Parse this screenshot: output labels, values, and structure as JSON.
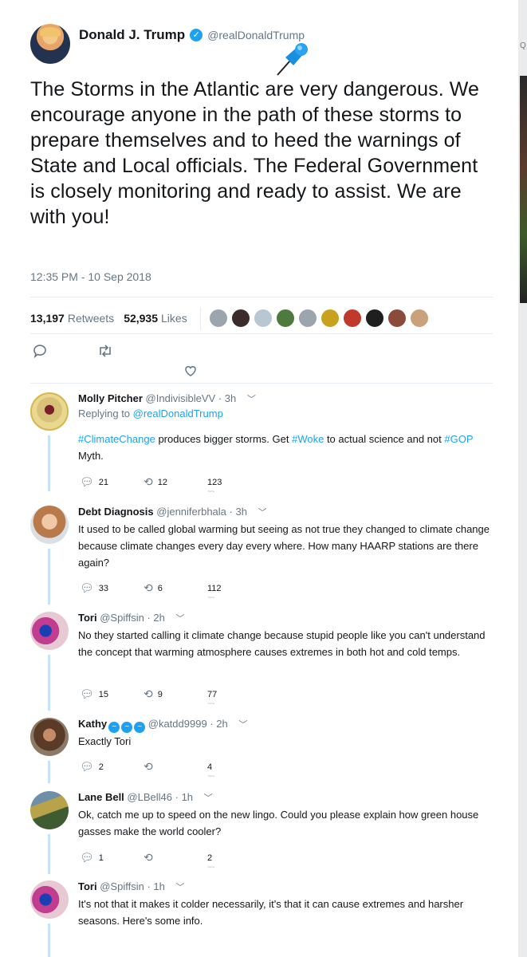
{
  "colors": {
    "accent": "#1da1f2",
    "muted": "#657786",
    "text": "#14171a",
    "thread": "#c5e3f6"
  },
  "main_tweet": {
    "display_name": "Donald J. Trump",
    "handle": "@realDonaldTrump",
    "text": "The Storms in the Atlantic are very dangerous. We encourage anyone in the path of these storms to prepare themselves and to heed the warnings of State and Local officials. The Federal Government is closely monitoring and ready to assist. We are with you!",
    "timestamp": "12:35 PM - 10 Sep 2018",
    "retweets_count": "13,197",
    "retweets_label": "Retweets",
    "likes_count": "52,935",
    "likes_label": "Likes",
    "icons": [
      "reply-icon",
      "retweet-icon",
      "like-icon",
      "pin-icon",
      "verified-badge-icon"
    ]
  },
  "gutter_mark": "Q",
  "replies": [
    {
      "name": "Molly Pitcher",
      "handle": "@IndivisibleVV",
      "time": "· 3h",
      "replying_prefix": "Replying to ",
      "replying_to": "@realDonaldTrump",
      "text_parts": [
        "#ClimateChange",
        " produces bigger storms. Get ",
        "#Woke",
        " to actual science and not ",
        "#GOP",
        " Myth."
      ],
      "reply_count": "21",
      "retweet_count": "12",
      "like_count": "123"
    },
    {
      "name": "Debt Diagnosis",
      "handle": "@jenniferbhala",
      "time": "· 3h",
      "text": "It used to be called global warming but seeing as not true they changed to climate change because climate changes every day every where. How many HAARP stations are there again?",
      "reply_count": "33",
      "retweet_count": "6",
      "like_count": "112"
    },
    {
      "name": "Tori",
      "handle": "@Spiffsin",
      "time": "· 2h",
      "text": "No they started calling it climate change because stupid people like you can't understand the concept that warming atmosphere causes extremes in both hot and cold temps.",
      "reply_count": "15",
      "retweet_count": "9",
      "like_count": "77"
    },
    {
      "name": "Kathy",
      "handle": "@katdd9999",
      "time": "· 2h",
      "text": "Exactly Tori",
      "reply_count": "2",
      "retweet_count": "",
      "like_count": "4"
    },
    {
      "name": "Lane Bell",
      "handle": "@LBell46",
      "time": "· 1h",
      "text": "Ok, catch me up to speed on the new lingo. Could you please explain how green house gasses make the world cooler?",
      "reply_count": "1",
      "retweet_count": "",
      "like_count": "2"
    },
    {
      "name": "Tori",
      "handle": "@Spiffsin",
      "time": "· 1h",
      "text": "It's not that it makes it colder necessarily, it's that it can cause extremes and harsher seasons. Here's some info."
    }
  ]
}
